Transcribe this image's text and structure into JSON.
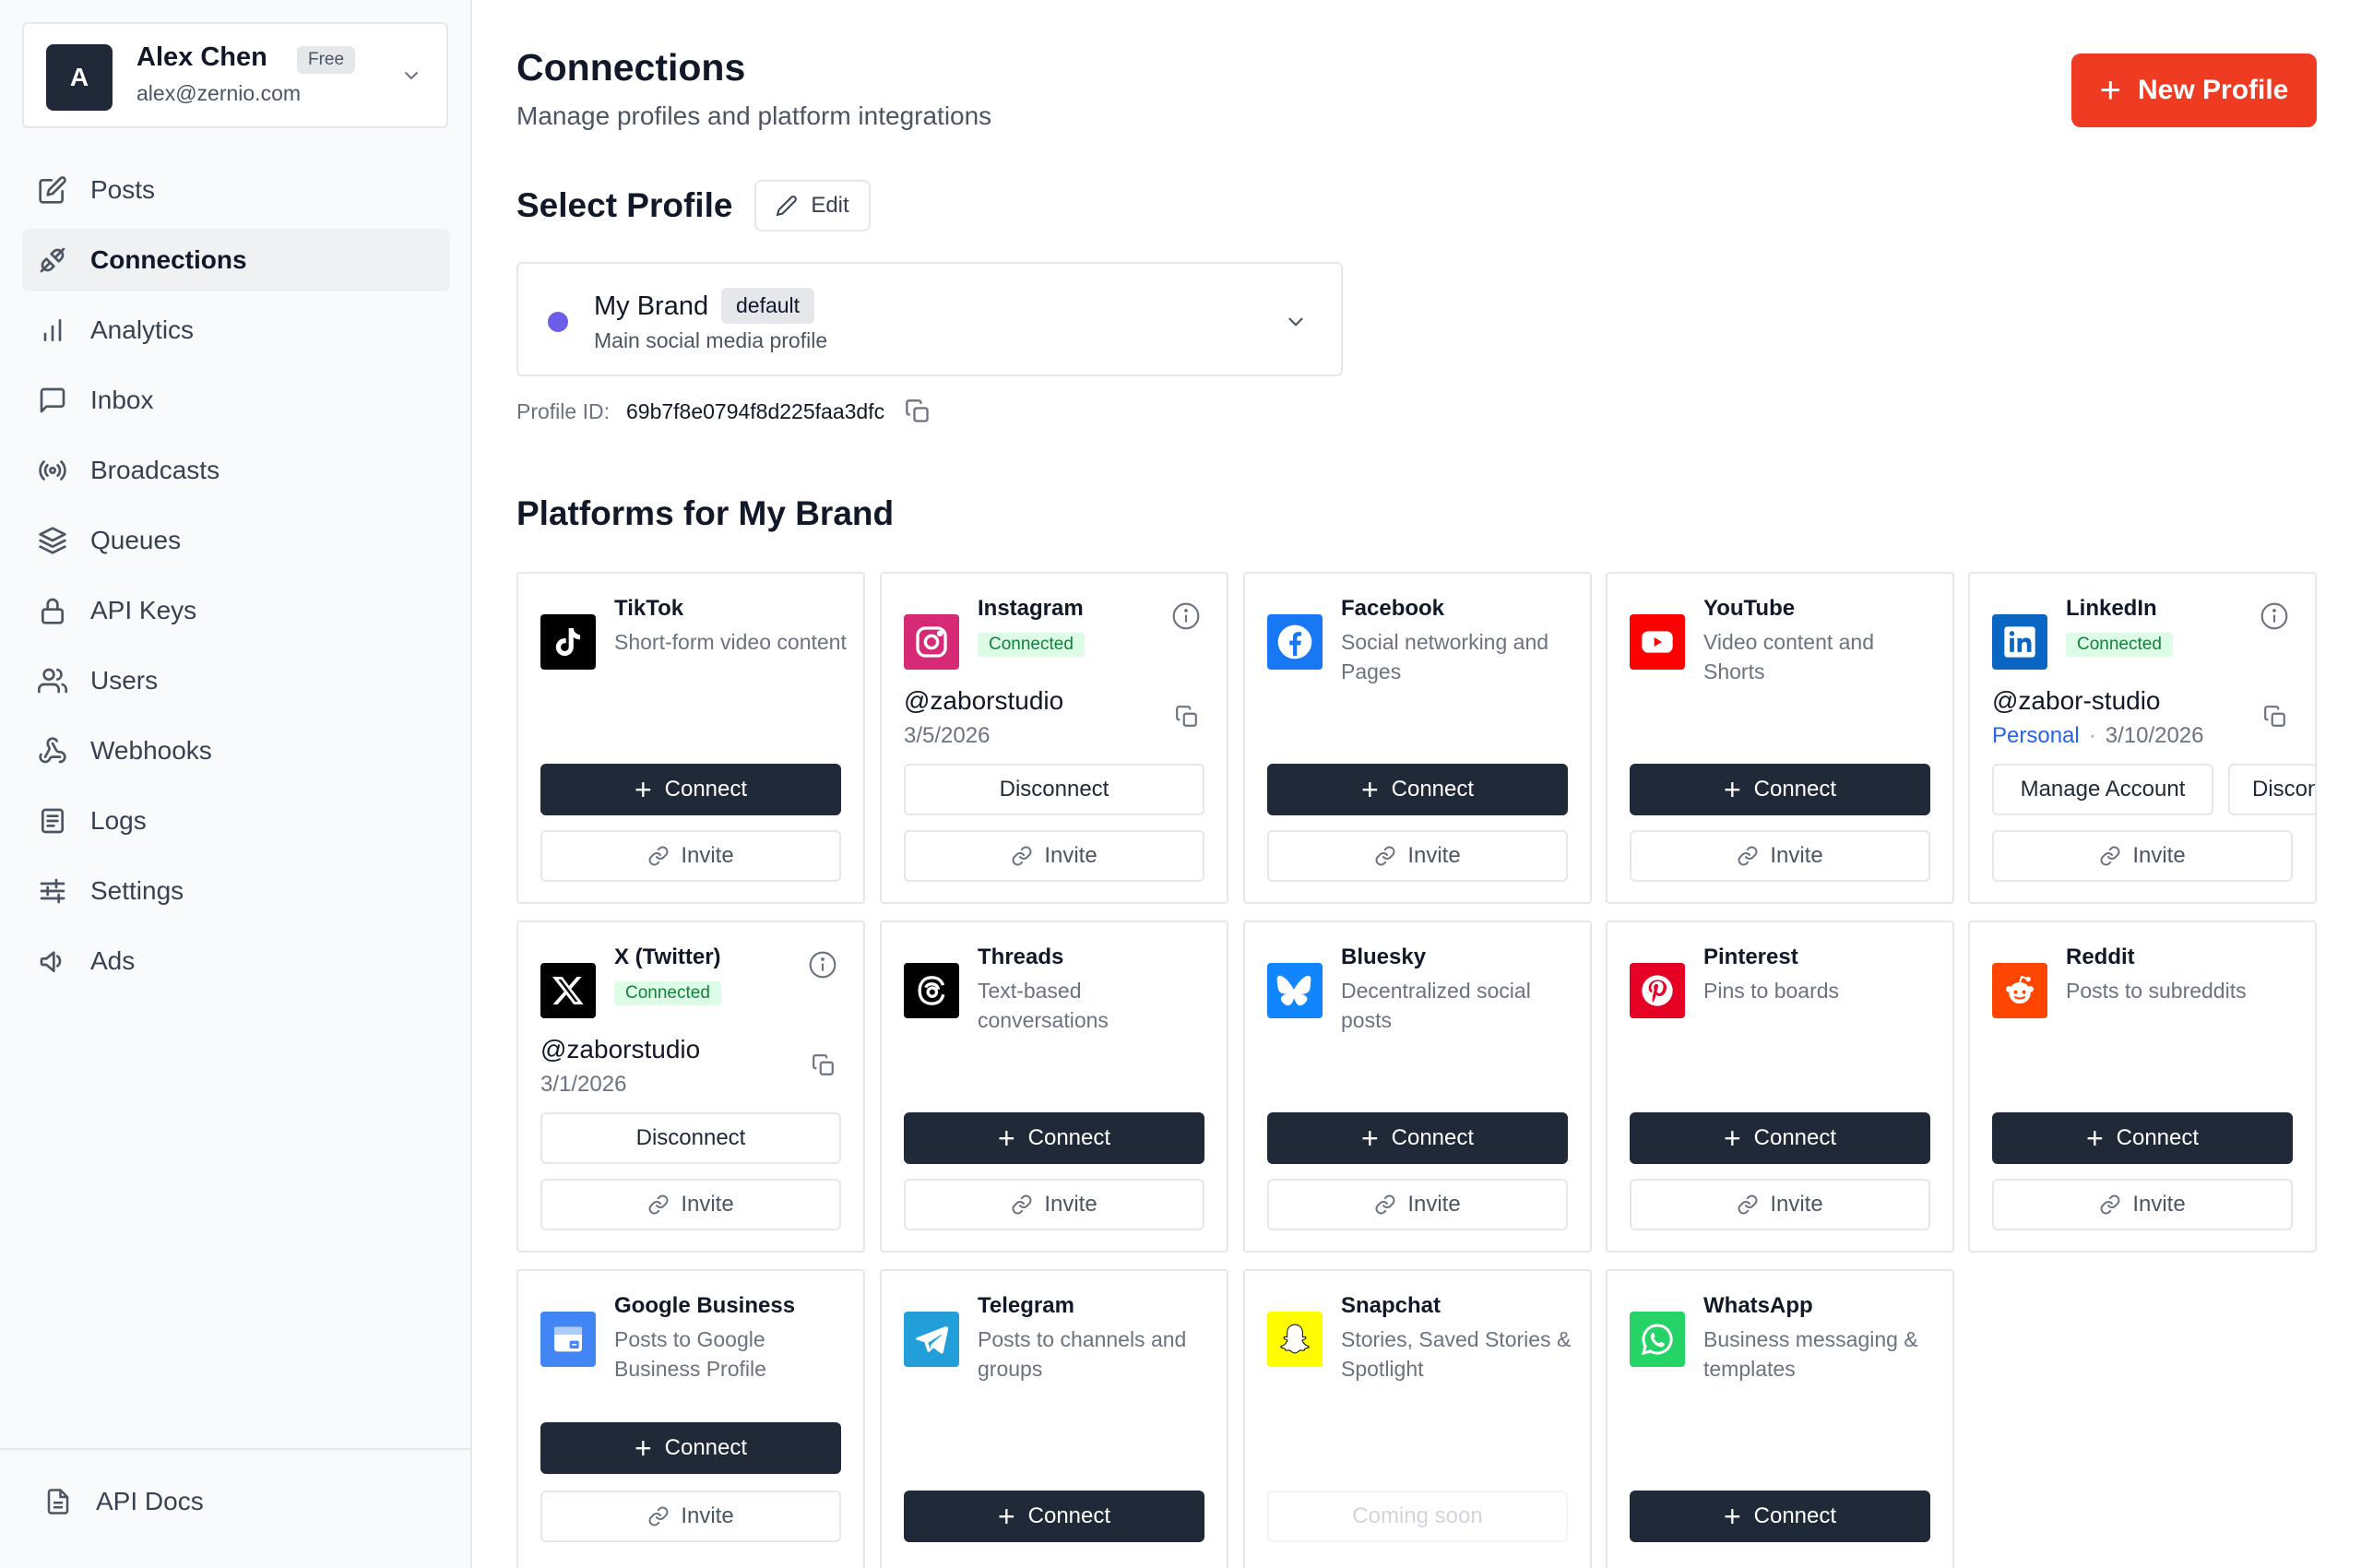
{
  "account": {
    "initial": "A",
    "name": "Alex Chen",
    "plan": "Free",
    "email": "alex@zernio.com"
  },
  "nav": [
    {
      "label": "Posts",
      "icon": "edit-icon"
    },
    {
      "label": "Connections",
      "icon": "plug-icon",
      "active": true
    },
    {
      "label": "Analytics",
      "icon": "bar-chart-icon"
    },
    {
      "label": "Inbox",
      "icon": "message-icon"
    },
    {
      "label": "Broadcasts",
      "icon": "radio-icon"
    },
    {
      "label": "Queues",
      "icon": "layers-icon"
    },
    {
      "label": "API Keys",
      "icon": "lock-icon"
    },
    {
      "label": "Users",
      "icon": "users-icon"
    },
    {
      "label": "Webhooks",
      "icon": "webhook-icon"
    },
    {
      "label": "Logs",
      "icon": "log-icon"
    },
    {
      "label": "Settings",
      "icon": "sliders-icon"
    },
    {
      "label": "Ads",
      "icon": "megaphone-icon"
    }
  ],
  "footer": {
    "docs_label": "API Docs"
  },
  "header": {
    "title": "Connections",
    "subtitle": "Manage profiles and platform integrations",
    "new_profile_label": "New Profile"
  },
  "profile": {
    "section_title": "Select Profile",
    "edit_label": "Edit",
    "name": "My Brand",
    "badge": "default",
    "description": "Main social media profile",
    "dot_color": "#6d5ee8",
    "id_label": "Profile ID:",
    "id_value": "69b7f8e0794f8d225faa3dfc"
  },
  "platforms_title": "Platforms for My Brand",
  "labels": {
    "connect": "Connect",
    "invite": "Invite",
    "disconnect": "Disconnect",
    "manage": "Manage Account",
    "disconnect_short": "Disconnec",
    "coming_soon": "Coming soon",
    "connected": "Connected",
    "personal": "Personal"
  },
  "platforms": [
    {
      "name": "TikTok",
      "desc": "Short-form video content",
      "color": "#000000"
    },
    {
      "name": "Instagram",
      "connected": true,
      "handle": "@zaborstudio",
      "date": "3/5/2026",
      "color": "#d62976"
    },
    {
      "name": "Facebook",
      "desc": "Social networking and Pages",
      "color": "#1877f2"
    },
    {
      "name": "YouTube",
      "desc": "Video content and Shorts",
      "color": "#ff0000"
    },
    {
      "name": "LinkedIn",
      "connected": true,
      "handle": "@zabor-studio",
      "account_type": "Personal",
      "date": "3/10/2026",
      "color": "#0a66c2"
    },
    {
      "name": "X (Twitter)",
      "connected": true,
      "handle": "@zaborstudio",
      "date": "3/1/2026",
      "color": "#000000"
    },
    {
      "name": "Threads",
      "desc": "Text-based conversations",
      "color": "#000000"
    },
    {
      "name": "Bluesky",
      "desc": "Decentralized social posts",
      "color": "#1185fe"
    },
    {
      "name": "Pinterest",
      "desc": "Pins to boards",
      "color": "#e60023"
    },
    {
      "name": "Reddit",
      "desc": "Posts to subreddits",
      "color": "#ff4500"
    },
    {
      "name": "Google Business",
      "desc": "Posts to Google Business Profile",
      "color": "#4285f4"
    },
    {
      "name": "Telegram",
      "desc": "Posts to channels and groups",
      "color": "#229ed9"
    },
    {
      "name": "Snapchat",
      "desc": "Stories, Saved Stories & Spotlight",
      "color": "#fffc00"
    },
    {
      "name": "WhatsApp",
      "desc": "Business messaging & templates",
      "color": "#25d366"
    }
  ]
}
